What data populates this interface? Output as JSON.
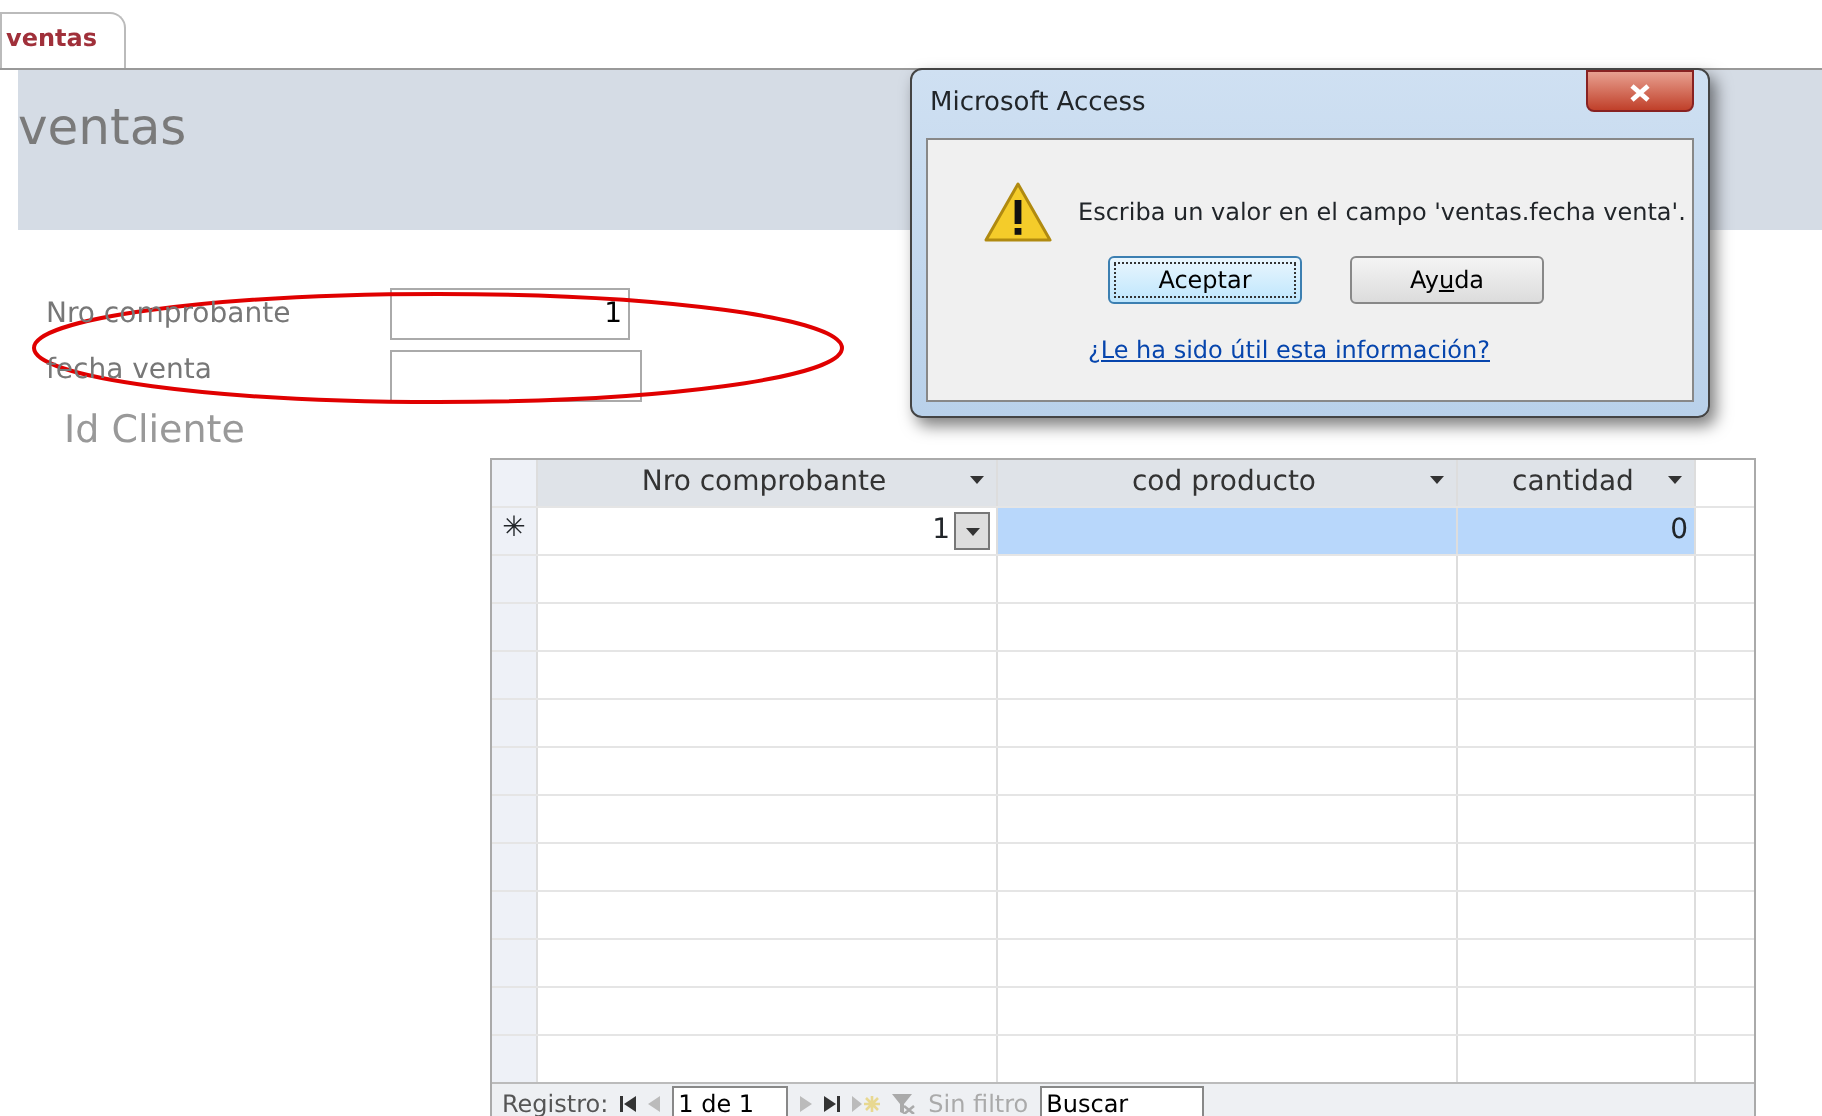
{
  "tab": {
    "label": "ventas",
    "selected": true
  },
  "form_title": "ventas",
  "fields": [
    {
      "label": "Nro comprobante",
      "value": "1"
    },
    {
      "label": "fecha venta"
    }
  ],
  "annotation": {
    "kind": "ellipse",
    "color": "#e00000"
  },
  "subform_label": "Id Cliente",
  "grid": {
    "columns": [
      {
        "label": "Nro comprobante"
      },
      {
        "label": "cod producto"
      },
      {
        "label": "cantidad"
      }
    ],
    "new_row": {
      "marker": "✳",
      "cells": [
        {
          "kind": "combo",
          "value": "1",
          "selected": false
        },
        {
          "kind": "text",
          "selected": true
        },
        {
          "kind": "number",
          "value": "0",
          "selected": true
        }
      ]
    }
  },
  "navigation": {
    "label": "Registro:",
    "position": "1 de 1",
    "filter": "Sin filtro",
    "search_placeholder": "Buscar"
  },
  "dialog": {
    "title": "Microsoft Access",
    "message": "Escriba un valor en el campo 'ventas.fecha venta'.",
    "buttons": [
      {
        "label": "Aceptar",
        "default": true
      },
      {
        "label_parts": {
          "before": "Ay",
          "access_key": "u",
          "after": "da"
        },
        "default": false
      }
    ],
    "help_link": "¿Le ha sido útil esta información?"
  }
}
